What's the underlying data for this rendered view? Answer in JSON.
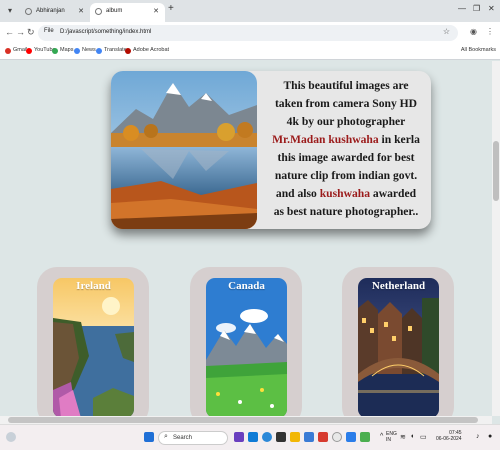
{
  "browser": {
    "tabs": [
      {
        "label": "Abhiranjan",
        "active": false
      },
      {
        "label": "album",
        "active": true
      }
    ],
    "address": {
      "scheme_label": "File",
      "url": "D:/javascript/something/index.html"
    },
    "bookmarks": [
      {
        "label": "Gmail",
        "color": "#d93025"
      },
      {
        "label": "YouTube",
        "color": "#ff0000"
      },
      {
        "label": "Maps",
        "color": "#34a853"
      },
      {
        "label": "News",
        "color": "#4285f4"
      },
      {
        "label": "Translate",
        "color": "#4285f4"
      },
      {
        "label": "Adobe Acrobat",
        "color": "#b30b00"
      }
    ],
    "all_bookmarks_label": "All Bookmarks"
  },
  "hero": {
    "text_part1": "This beautiful images are taken from camera Sony HD 4k by our photographer ",
    "highlight1": "Mr.Madan kushwaha",
    "text_part2": " in kerla this image awarded for best nature clip from indian govt. and also ",
    "highlight2": "kushwaha",
    "text_part3": " awarded as best nature photographer..",
    "highlight_color": "#9b1b1b"
  },
  "cards": [
    {
      "title": "Ireland"
    },
    {
      "title": "Canada"
    },
    {
      "title": "Netherland"
    }
  ],
  "taskbar": {
    "search_label": "Search",
    "lang_line1": "ENG",
    "lang_line2": "IN",
    "time": "07:45",
    "date": "06-06-2024"
  }
}
